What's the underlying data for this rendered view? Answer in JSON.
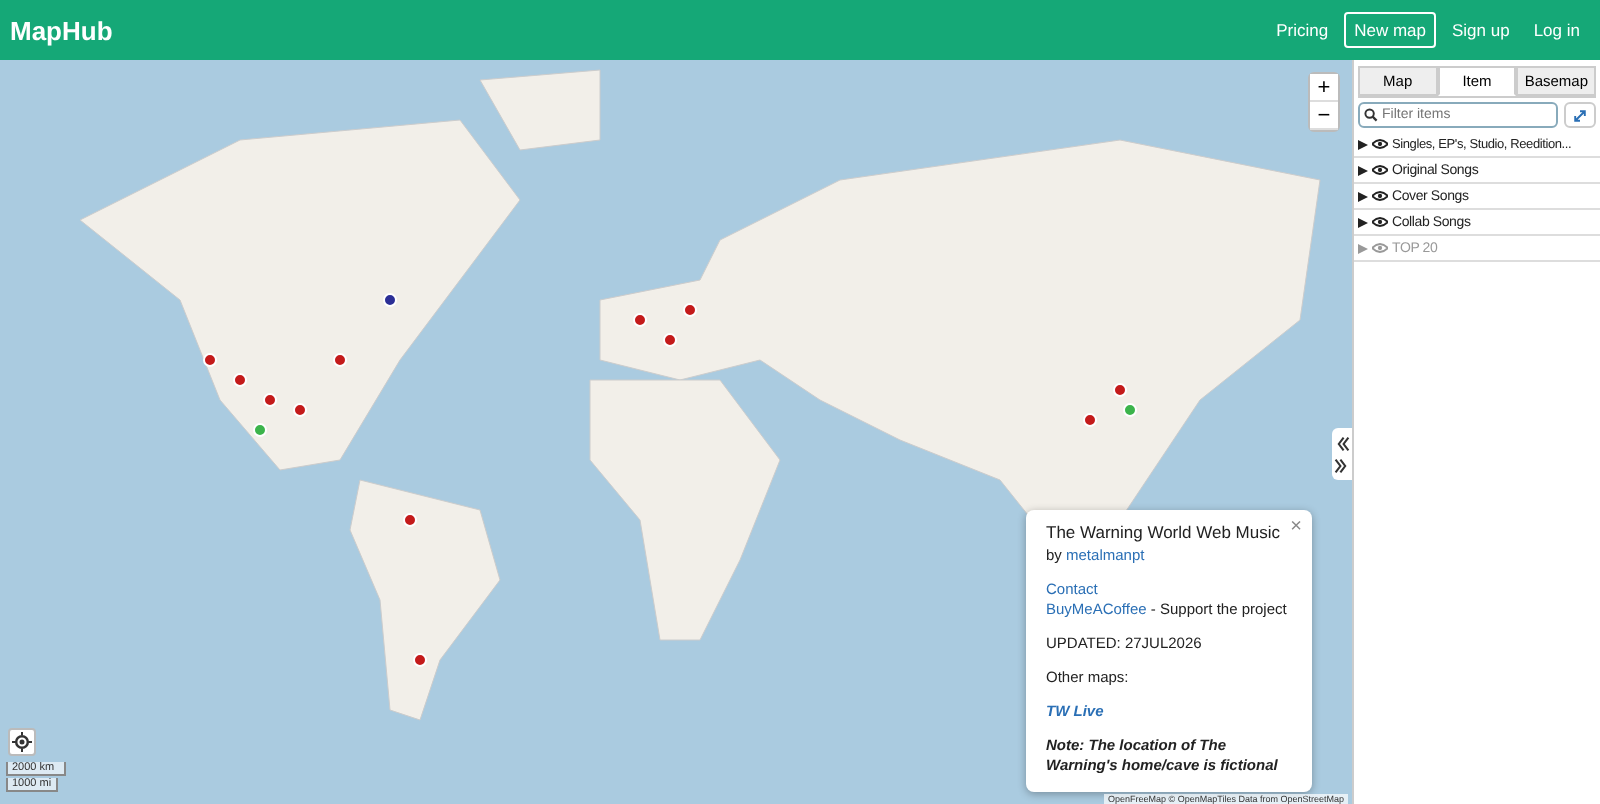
{
  "header": {
    "logo": "MapHub",
    "nav": [
      {
        "label": "Pricing",
        "kind": "link"
      },
      {
        "label": "New map",
        "kind": "outlined"
      },
      {
        "label": "Sign up",
        "kind": "link"
      },
      {
        "label": "Log in",
        "kind": "link"
      }
    ]
  },
  "map": {
    "zoom_in": "+",
    "zoom_out": "−",
    "scale": [
      "2000 km",
      "1000 mi"
    ],
    "attribution": "OpenFreeMap © OpenMapTiles Data from OpenStreetMap",
    "popup": {
      "close": "×",
      "title": "The Warning World Web Music",
      "by": "by",
      "author": "metalmanpt",
      "contact": "Contact",
      "coffee": "BuyMeACoffee",
      "coffee_note": " - Support the project",
      "updated": "UPDATED: 27JUL2026",
      "other": "Other maps:",
      "other_link": "TW Live",
      "note": "Note: The location of The Warning's home/cave is fictional"
    }
  },
  "sidebar": {
    "tabs": [
      {
        "label": "Map",
        "selected": false
      },
      {
        "label": "Item",
        "selected": true
      },
      {
        "label": "Basemap",
        "selected": false
      }
    ],
    "search": {
      "placeholder": "Filter items"
    },
    "items": [
      {
        "label": "Singles, EP's, Studio, Reedition...",
        "disabled": false
      },
      {
        "label": "Original Songs",
        "disabled": false
      },
      {
        "label": "Cover Songs",
        "disabled": false
      },
      {
        "label": "Collab Songs",
        "disabled": false
      },
      {
        "label": "TOP 20",
        "disabled": true
      }
    ]
  }
}
